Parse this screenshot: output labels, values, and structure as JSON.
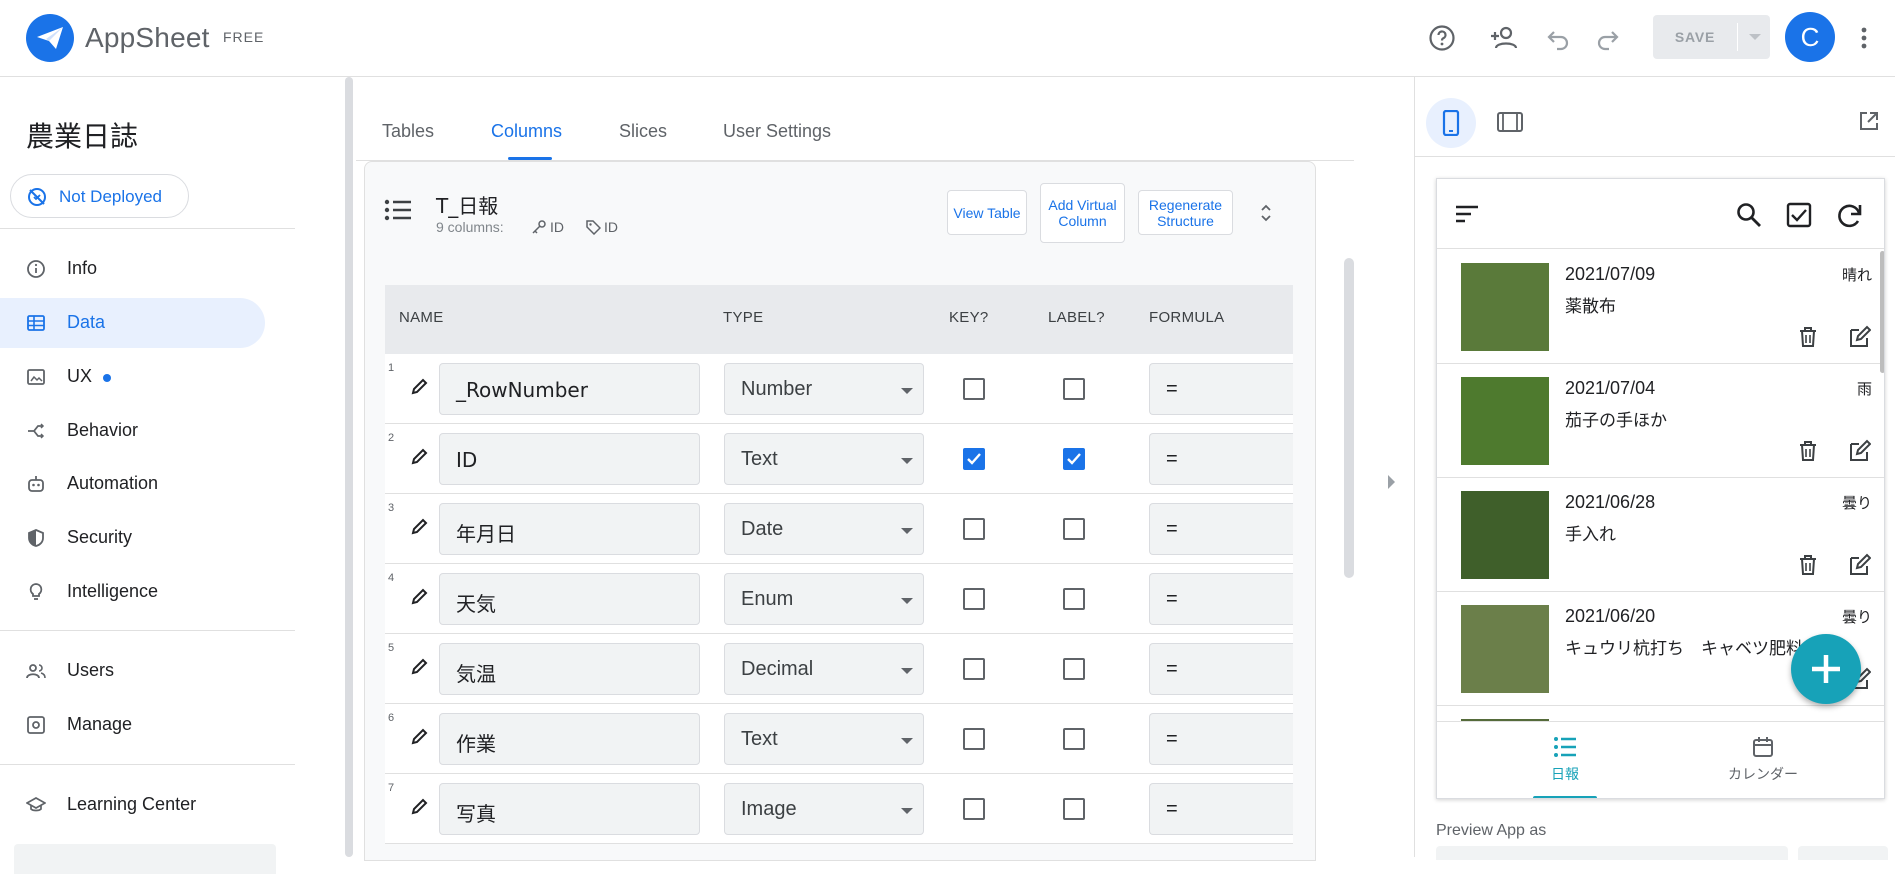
{
  "header": {
    "brand": "AppSheet",
    "plan": "FREE",
    "save_label": "SAVE",
    "avatar_initial": "C"
  },
  "sidebar": {
    "app_name": "農業日誌",
    "deploy_status": "Not Deployed",
    "items": [
      {
        "label": "Info",
        "icon": "info-icon"
      },
      {
        "label": "Data",
        "icon": "data-icon",
        "active": true
      },
      {
        "label": "UX",
        "icon": "ux-icon",
        "badge_dot": true
      },
      {
        "label": "Behavior",
        "icon": "behavior-icon"
      },
      {
        "label": "Automation",
        "icon": "automation-icon"
      },
      {
        "label": "Security",
        "icon": "shield-icon"
      },
      {
        "label": "Intelligence",
        "icon": "lightbulb-icon"
      },
      {
        "label": "Users",
        "icon": "users-icon"
      },
      {
        "label": "Manage",
        "icon": "manage-icon"
      },
      {
        "label": "Learning Center",
        "icon": "school-icon"
      }
    ]
  },
  "tabs": [
    "Tables",
    "Columns",
    "Slices",
    "User Settings"
  ],
  "active_tab": "Columns",
  "table": {
    "name": "T_日報",
    "columns_count": "9 columns:",
    "key_column": "ID",
    "label_column": "ID",
    "buttons": {
      "view": "View Table",
      "add_virtual": "Add Virtual Column",
      "regenerate": "Regenerate Structure"
    },
    "headers": [
      "NAME",
      "TYPE",
      "KEY?",
      "LABEL?",
      "FORMULA"
    ],
    "rows": [
      {
        "num": "1",
        "name": "_RowNumber",
        "type": "Number",
        "key": false,
        "label": false,
        "formula": "="
      },
      {
        "num": "2",
        "name": "ID",
        "type": "Text",
        "key": true,
        "label": true,
        "formula": "="
      },
      {
        "num": "3",
        "name": "年月日",
        "type": "Date",
        "key": false,
        "label": false,
        "formula": "="
      },
      {
        "num": "4",
        "name": "天気",
        "type": "Enum",
        "key": false,
        "label": false,
        "formula": "="
      },
      {
        "num": "5",
        "name": "気温",
        "type": "Decimal",
        "key": false,
        "label": false,
        "formula": "="
      },
      {
        "num": "6",
        "name": "作業",
        "type": "Text",
        "key": false,
        "label": false,
        "formula": "="
      },
      {
        "num": "7",
        "name": "写真",
        "type": "Image",
        "key": false,
        "label": false,
        "formula": "="
      }
    ]
  },
  "preview": {
    "entries": [
      {
        "date": "2021/07/09",
        "task": "薬散布",
        "weather": "晴れ",
        "thumb_color": "#5a7a3a"
      },
      {
        "date": "2021/07/04",
        "task": "茄子の手ほか",
        "weather": "雨",
        "thumb_color": "#4e7a2e"
      },
      {
        "date": "2021/06/28",
        "task": "手入れ",
        "weather": "曇り",
        "thumb_color": "#3f5f2a"
      },
      {
        "date": "2021/06/20",
        "task": "キュウリ杭打ち　キャベツ肥料",
        "weather": "曇り",
        "thumb_color": "#6b7f4a"
      }
    ],
    "nav": [
      {
        "label": "日報",
        "icon": "list-icon",
        "active": true
      },
      {
        "label": "カレンダー",
        "icon": "calendar-icon"
      }
    ],
    "preview_as_label": "Preview App as",
    "accent": "#17a2b8"
  },
  "colors": {
    "primary": "#1a73e8",
    "preview_accent": "#17a2b8"
  }
}
